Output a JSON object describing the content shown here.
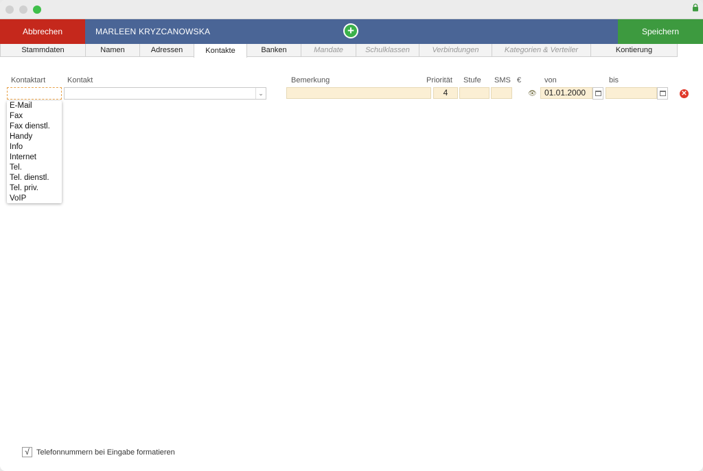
{
  "window": {
    "traffic_lights": [
      "close",
      "minimize",
      "zoom"
    ],
    "lock_icon": "lock-icon"
  },
  "toolbar": {
    "cancel_label": "Abbrechen",
    "person_name": "MARLEEN  KRYZCANOWSKA",
    "add_icon": "plus-circle-icon",
    "save_label": "Speichern",
    "colors": {
      "cancel": "#c5281c",
      "bar": "#4a6596",
      "save": "#3d9a3f"
    }
  },
  "tabs": [
    {
      "label": "Stammdaten",
      "state": "normal"
    },
    {
      "label": "Namen",
      "state": "normal"
    },
    {
      "label": "Adressen",
      "state": "normal"
    },
    {
      "label": "Kontakte",
      "state": "active"
    },
    {
      "label": "Banken",
      "state": "normal"
    },
    {
      "label": "Mandate",
      "state": "disabled"
    },
    {
      "label": "Schulklassen",
      "state": "disabled"
    },
    {
      "label": "Verbindungen",
      "state": "disabled"
    },
    {
      "label": "Kategorien & Verteiler",
      "state": "disabled"
    },
    {
      "label": "Kontierung",
      "state": "normal"
    }
  ],
  "columns": {
    "kontaktart": "Kontaktart",
    "kontakt": "Kontakt",
    "bemerkung": "Bemerkung",
    "prioritaet": "Priorität",
    "stufe": "Stufe",
    "sms": "SMS",
    "euro": "€",
    "von": "von",
    "bis": "bis"
  },
  "row": {
    "kontaktart": "",
    "kontakt": "",
    "bemerkung": "",
    "prioritaet": "4",
    "stufe": "",
    "sms": "",
    "von": "01.01.2000",
    "bis": ""
  },
  "dropdown_options": [
    "E-Mail",
    "Fax",
    "Fax dienstl.",
    "Handy",
    "Info",
    "Internet",
    "Tel.",
    "Tel. dienstl.",
    "Tel. priv.",
    "VoIP"
  ],
  "footer": {
    "checkbox_checked": true,
    "checkbox_mark": "√",
    "checkbox_label": "Telefonnummern bei Eingabe formatieren"
  }
}
